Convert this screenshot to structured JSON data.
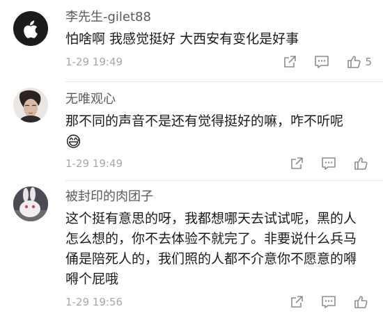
{
  "comments": [
    {
      "username": "李先生-gilet88",
      "content": "怕啥啊 我感觉挺好 大西安有变化是好事",
      "time": "1-29 19:49",
      "likes": "5",
      "avatar_icon": "apple-logo-icon"
    },
    {
      "username": "无唯观心",
      "content": "那不同的声音不是还有觉得挺好的嘛，咋不听呢",
      "emoji": "😅",
      "time": "1-29 19:49",
      "likes": "",
      "avatar_icon": "portrait-avatar"
    },
    {
      "username": "被封印的肉团子",
      "content": "这个挺有意思的呀，我都想哪天去试试呢，黑的人怎么想的，你不去体验不就完了。非要说什么兵马俑是陪死人的，我们照的人都不介意你不愿意的嘚嘚个屁哦",
      "time": "1-29 19:56",
      "likes": "",
      "avatar_icon": "rabbit-avatar"
    }
  ],
  "colors": {
    "meta_text": "#a7a7a7",
    "icon_stroke": "#8c8c8c",
    "divider": "#e6e6e6"
  }
}
